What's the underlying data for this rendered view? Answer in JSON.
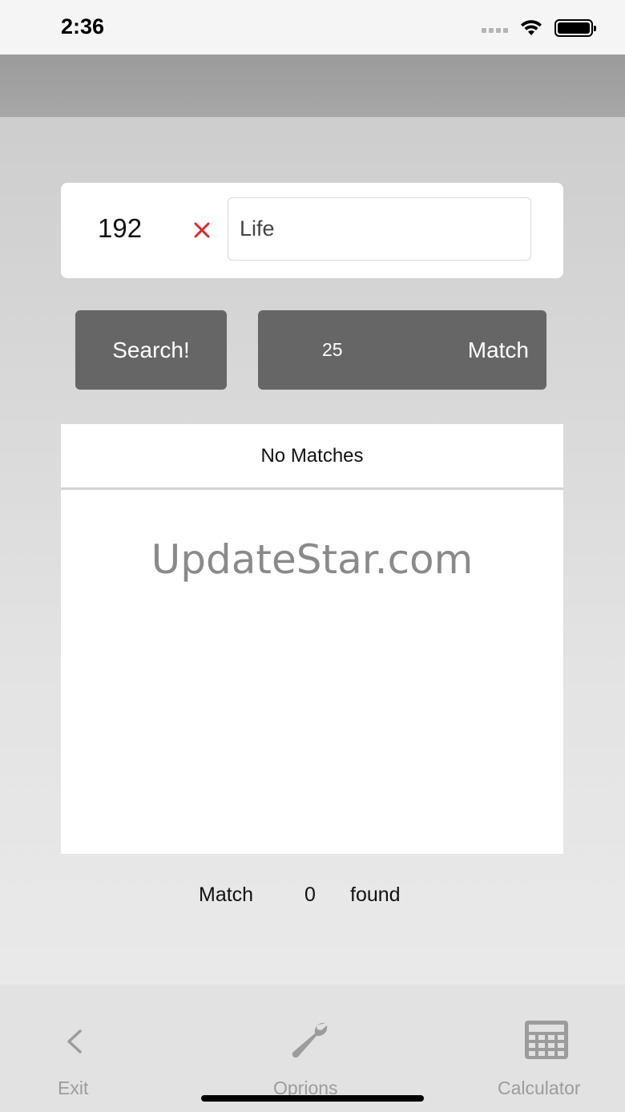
{
  "status_bar": {
    "time": "2:36"
  },
  "search": {
    "number_value": "192",
    "text_value": "Life"
  },
  "buttons": {
    "search_label": "Search!",
    "match_count": "25",
    "match_label": "Match"
  },
  "results": {
    "header": "No Matches",
    "watermark": "UpdateStar.com"
  },
  "summary": {
    "prefix": "Match",
    "count": "0",
    "suffix": "found"
  },
  "tab_bar": {
    "exit_label": "Exit",
    "options_label": "Oprions",
    "calculator_label": "Calculator"
  },
  "colors": {
    "button_bg": "#666666",
    "clear_icon": "#d32f2f",
    "tab_text": "#9c9c9c"
  },
  "icons": {
    "exit": "chevron-left-icon",
    "options": "wrench-icon",
    "calculator": "calculator-icon",
    "clear": "close-icon"
  }
}
